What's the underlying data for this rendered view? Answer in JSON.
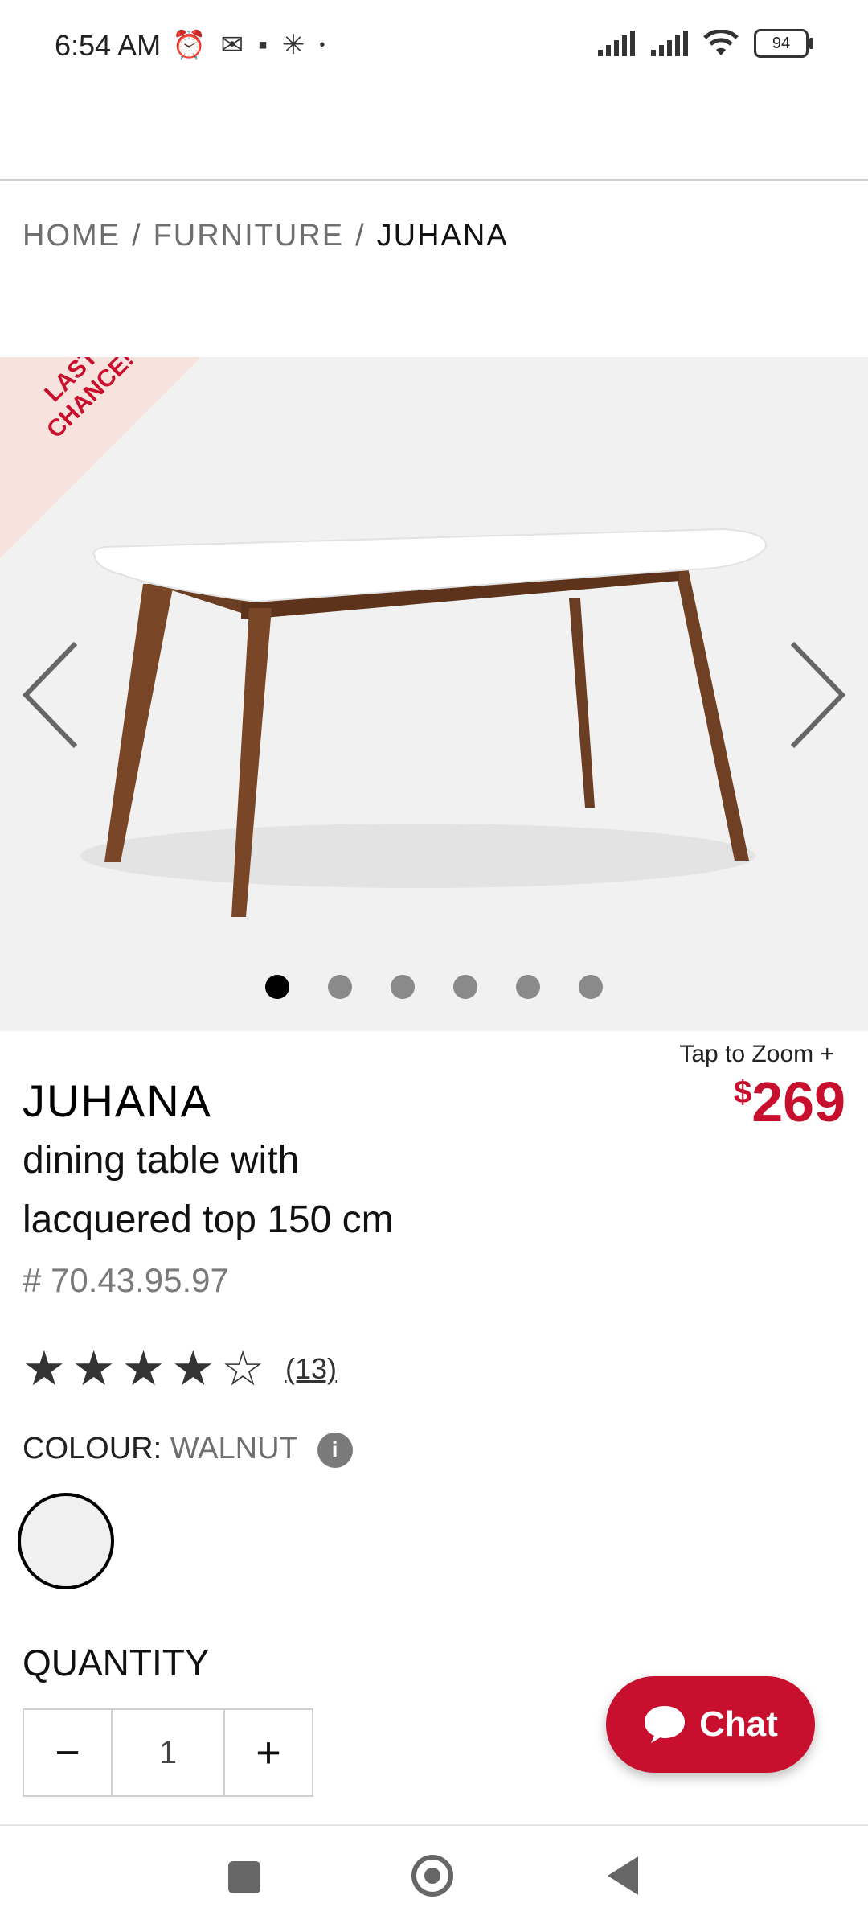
{
  "status": {
    "time": "6:54 AM",
    "battery": "94",
    "icons": [
      "alarm-icon",
      "mail-icon",
      "notification-icon",
      "walmart-icon",
      "dot-icon",
      "signal-icon",
      "signal-icon",
      "wifi-icon",
      "battery-icon"
    ]
  },
  "breadcrumb": {
    "home": "HOME",
    "sep1": "/",
    "furniture": "FURNITURE",
    "sep2": "/",
    "current": "JUHANA"
  },
  "carousel": {
    "ribbon_line1": "LAST",
    "ribbon_line2": "CHANCE!",
    "active_index": 0,
    "count": 6
  },
  "product": {
    "zoom_label": "Tap to Zoom",
    "zoom_plus": "+",
    "currency": "$",
    "price": "269",
    "brand": "JUHANA",
    "description_line1": "dining table with",
    "description_line2": "lacquered top 150 cm",
    "sku": "# 70.43.95.97",
    "rating": 4,
    "rating_max": 5,
    "reviews": "(13)",
    "colour_label": "COLOUR:",
    "colour_value": "WALNUT",
    "quantity_label": "QUANTITY",
    "quantity_value": "1",
    "minus": "−",
    "plus": "+"
  },
  "chat": {
    "label": "Chat"
  },
  "colors": {
    "accent": "#c8102e",
    "image_bg": "#f1f1f1"
  }
}
